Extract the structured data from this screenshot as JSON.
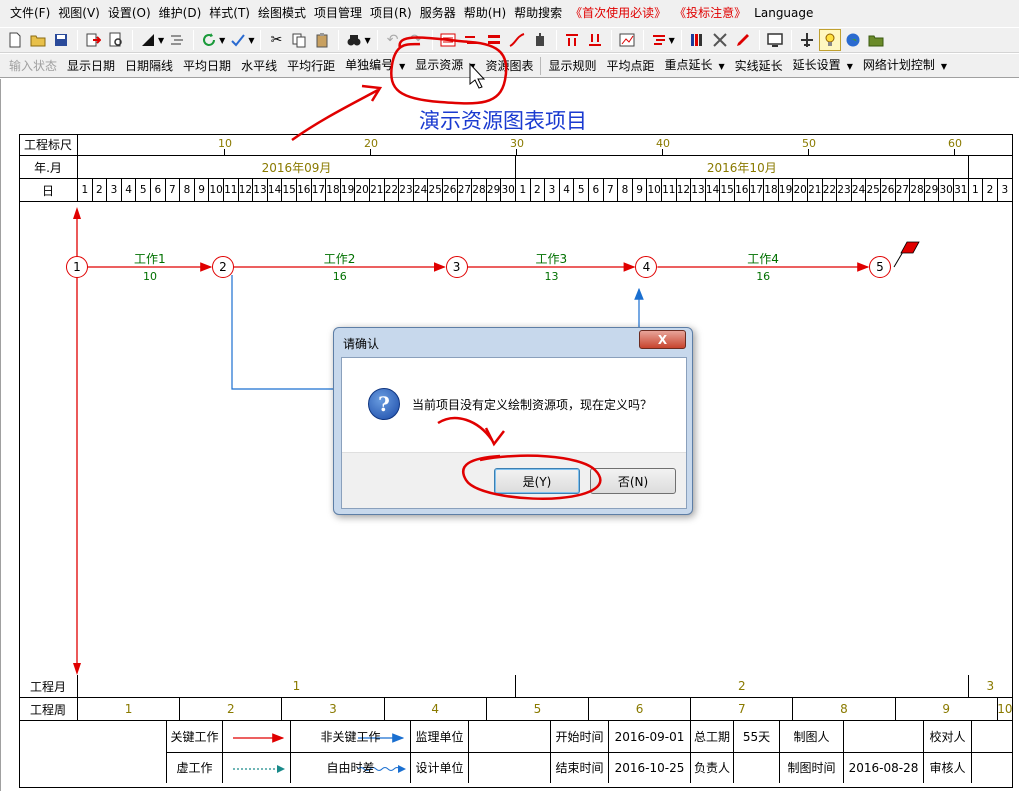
{
  "menubar": {
    "items": [
      {
        "label": "文件(F)",
        "red": false
      },
      {
        "label": "视图(V)",
        "red": false
      },
      {
        "label": "设置(O)",
        "red": false
      },
      {
        "label": "维护(D)",
        "red": false
      },
      {
        "label": "样式(T)",
        "red": false
      },
      {
        "label": "绘图模式",
        "red": false
      },
      {
        "label": "项目管理",
        "red": false
      },
      {
        "label": "项目(R)",
        "red": false
      },
      {
        "label": "服务器",
        "red": false
      },
      {
        "label": "帮助(H)",
        "red": false
      },
      {
        "label": "帮助搜索",
        "red": false
      },
      {
        "label": "《首次使用必读》",
        "red": true
      },
      {
        "label": "《投标注意》",
        "red": true
      },
      {
        "label": "Language",
        "red": false
      }
    ]
  },
  "toolbar2": {
    "items": [
      {
        "label": "输入状态",
        "disabled": true,
        "dropdown": false
      },
      {
        "label": "显示日期",
        "disabled": false,
        "dropdown": false
      },
      {
        "label": "日期隔线",
        "disabled": false,
        "dropdown": false
      },
      {
        "label": "平均日期",
        "disabled": false,
        "dropdown": false
      },
      {
        "label": "水平线",
        "disabled": false,
        "dropdown": false
      },
      {
        "label": "平均行距",
        "disabled": false,
        "dropdown": false
      },
      {
        "label": "单独编号",
        "disabled": false,
        "dropdown": true
      },
      {
        "label": "显示资源",
        "disabled": false,
        "dropdown": true
      },
      {
        "label": "资源图表",
        "disabled": false,
        "dropdown": false
      },
      {
        "label": "显示规则",
        "disabled": false,
        "dropdown": false
      },
      {
        "label": "平均点距",
        "disabled": false,
        "dropdown": false
      },
      {
        "label": "重点延长",
        "disabled": false,
        "dropdown": true
      },
      {
        "label": "实线延长",
        "disabled": false,
        "dropdown": false
      },
      {
        "label": "延长设置",
        "disabled": false,
        "dropdown": true
      },
      {
        "label": "网络计划控制",
        "disabled": false,
        "dropdown": true
      }
    ]
  },
  "annotation": {
    "text": "演示资源图表项目"
  },
  "header": {
    "ruler_label": "工程标尺",
    "ruler_ticks": [
      "10",
      "20",
      "30",
      "40",
      "50",
      "60"
    ],
    "month_label": "年.月",
    "months": [
      "2016年09月",
      "2016年10月"
    ],
    "day_label": "日",
    "days": [
      "1",
      "2",
      "3",
      "4",
      "5",
      "6",
      "7",
      "8",
      "9",
      "10",
      "11",
      "12",
      "13",
      "14",
      "15",
      "16",
      "17",
      "18",
      "19",
      "20",
      "21",
      "22",
      "23",
      "24",
      "25",
      "26",
      "27",
      "28",
      "29",
      "30",
      "1",
      "2",
      "3",
      "4",
      "5",
      "6",
      "7",
      "8",
      "9",
      "10",
      "11",
      "12",
      "13",
      "14",
      "15",
      "16",
      "17",
      "18",
      "19",
      "20",
      "21",
      "22",
      "23",
      "24",
      "25",
      "26",
      "27",
      "28",
      "29",
      "30",
      "31",
      "1",
      "2",
      "3"
    ]
  },
  "network": {
    "nodes": [
      "1",
      "2",
      "3",
      "4",
      "5"
    ],
    "tasks": [
      {
        "name": "工作1",
        "duration": "10"
      },
      {
        "name": "工作2",
        "duration": "16"
      },
      {
        "name": "工作3",
        "duration": "13"
      },
      {
        "name": "工作4",
        "duration": "16"
      }
    ]
  },
  "footer": {
    "month_row_label": "工程月",
    "month_values": [
      "1",
      "2",
      "3"
    ],
    "week_row_label": "工程周",
    "week_values": [
      "1",
      "2",
      "3",
      "4",
      "5",
      "6",
      "7",
      "8",
      "9",
      "10"
    ]
  },
  "legend": {
    "critical": "关键工作",
    "noncritical": "非关键工作",
    "dummy": "虚工作",
    "free_float": "自由时差",
    "supervisor": "监理单位",
    "designer": "设计单位",
    "start_label": "开始时间",
    "start_value": "2016-09-01",
    "end_label": "结束时间",
    "end_value": "2016-10-25",
    "total_label": "总工期",
    "total_value": "55天",
    "owner_label": "负责人",
    "drafter_label": "制图人",
    "draw_time_label": "制图时间",
    "draw_time_value": "2016-08-28",
    "checker_label": "校对人",
    "reviewer_label": "审核人"
  },
  "dialog": {
    "title": "请确认",
    "message": "当前项目没有定义绘制资源项，现在定义吗？",
    "yes_label": "是(Y)",
    "no_label": "否(N)",
    "close_label": "X"
  },
  "colors": {
    "critical": "#e00000",
    "noncritical": "#1a6fd0",
    "task_text": "#007000",
    "header_text": "#8a7a00",
    "highlight": "#e00000"
  }
}
